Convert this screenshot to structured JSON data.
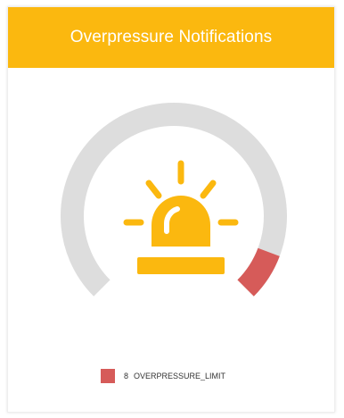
{
  "header": {
    "title": "Overpressure Notifications"
  },
  "gauge": {
    "track_color": "#dddddd",
    "value_color": "#d65b59",
    "icon": "siren-icon",
    "icon_color": "#fbb80f",
    "value_fraction": 0.09
  },
  "legend": {
    "items": [
      {
        "count": "8",
        "label": "OVERPRESSURE_LIMIT",
        "color": "#d65b59"
      }
    ]
  },
  "colors": {
    "header": "#fbb80f"
  }
}
